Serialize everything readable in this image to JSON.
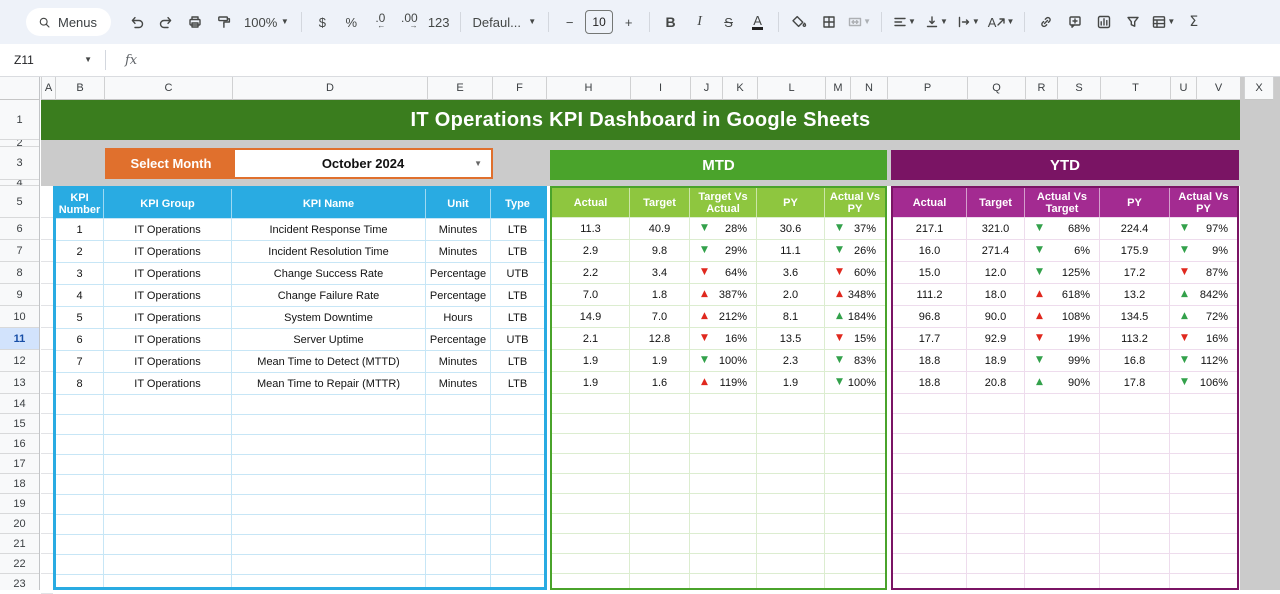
{
  "toolbar": {
    "menus": "Menus",
    "zoom": "100%",
    "currency": "$",
    "percent": "%",
    "decrease_decimals": ".0",
    "increase_decimals": ".00",
    "more_formats": "123",
    "font": "Defaul...",
    "decrease_font_size": "−",
    "font_size": "10",
    "increase_font_size": "+",
    "bold": "B",
    "italic": "I",
    "strikethrough": "S",
    "text_color": "A",
    "text_rotation": "A",
    "functions": "Σ"
  },
  "formula_bar": {
    "name_box": "Z11",
    "fx": "fx"
  },
  "sheet": {
    "columns": [
      "A",
      "B",
      "C",
      "D",
      "E",
      "F",
      "H",
      "I",
      "J",
      "K",
      "L",
      "M",
      "N",
      "P",
      "Q",
      "R",
      "S",
      "T",
      "U",
      "V",
      "X"
    ],
    "row_count": 23,
    "selected_row": 11,
    "title": "IT Operations KPI Dashboard in Google Sheets",
    "select_month_label": "Select Month",
    "select_month_value": "October 2024",
    "mtd_label": "MTD",
    "ytd_label": "YTD",
    "info_headers": [
      "KPI Number",
      "KPI Group",
      "KPI Name",
      "Unit",
      "Type"
    ],
    "mtd_headers": [
      "Actual",
      "Target",
      "Target Vs Actual",
      "PY",
      "Actual Vs PY"
    ],
    "ytd_headers": [
      "Actual",
      "Target",
      "Actual Vs Target",
      "PY",
      "Actual Vs PY"
    ]
  },
  "kpis": [
    {
      "number": "1",
      "group": "IT Operations",
      "name": "Incident Response Time",
      "unit": "Minutes",
      "type": "LTB",
      "mtd": {
        "actual": "11.3",
        "target": "40.9",
        "target_vs_actual": {
          "arrow": "down",
          "color": "green",
          "value": "28%"
        },
        "py": "30.6",
        "actual_vs_py": {
          "arrow": "down",
          "color": "green",
          "value": "37%"
        }
      },
      "ytd": {
        "actual": "217.1",
        "target": "321.0",
        "actual_vs_target": {
          "arrow": "down",
          "color": "green",
          "value": "68%"
        },
        "py": "224.4",
        "actual_vs_py": {
          "arrow": "down",
          "color": "green",
          "value": "97%"
        }
      }
    },
    {
      "number": "2",
      "group": "IT Operations",
      "name": "Incident Resolution Time",
      "unit": "Minutes",
      "type": "LTB",
      "mtd": {
        "actual": "2.9",
        "target": "9.8",
        "target_vs_actual": {
          "arrow": "down",
          "color": "green",
          "value": "29%"
        },
        "py": "11.1",
        "actual_vs_py": {
          "arrow": "down",
          "color": "green",
          "value": "26%"
        }
      },
      "ytd": {
        "actual": "16.0",
        "target": "271.4",
        "actual_vs_target": {
          "arrow": "down",
          "color": "green",
          "value": "6%"
        },
        "py": "175.9",
        "actual_vs_py": {
          "arrow": "down",
          "color": "green",
          "value": "9%"
        }
      }
    },
    {
      "number": "3",
      "group": "IT Operations",
      "name": "Change Success Rate",
      "unit": "Percentage",
      "type": "UTB",
      "mtd": {
        "actual": "2.2",
        "target": "3.4",
        "target_vs_actual": {
          "arrow": "down",
          "color": "red",
          "value": "64%"
        },
        "py": "3.6",
        "actual_vs_py": {
          "arrow": "down",
          "color": "red",
          "value": "60%"
        }
      },
      "ytd": {
        "actual": "15.0",
        "target": "12.0",
        "actual_vs_target": {
          "arrow": "down",
          "color": "green",
          "value": "125%"
        },
        "py": "17.2",
        "actual_vs_py": {
          "arrow": "down",
          "color": "red",
          "value": "87%"
        }
      }
    },
    {
      "number": "4",
      "group": "IT Operations",
      "name": "Change Failure Rate",
      "unit": "Percentage",
      "type": "LTB",
      "mtd": {
        "actual": "7.0",
        "target": "1.8",
        "target_vs_actual": {
          "arrow": "up",
          "color": "red",
          "value": "387%"
        },
        "py": "2.0",
        "actual_vs_py": {
          "arrow": "up",
          "color": "red",
          "value": "348%"
        }
      },
      "ytd": {
        "actual": "111.2",
        "target": "18.0",
        "actual_vs_target": {
          "arrow": "up",
          "color": "red",
          "value": "618%"
        },
        "py": "13.2",
        "actual_vs_py": {
          "arrow": "up",
          "color": "green",
          "value": "842%"
        }
      }
    },
    {
      "number": "5",
      "group": "IT Operations",
      "name": "System Downtime",
      "unit": "Hours",
      "type": "LTB",
      "mtd": {
        "actual": "14.9",
        "target": "7.0",
        "target_vs_actual": {
          "arrow": "up",
          "color": "red",
          "value": "212%"
        },
        "py": "8.1",
        "actual_vs_py": {
          "arrow": "up",
          "color": "green",
          "value": "184%"
        }
      },
      "ytd": {
        "actual": "96.8",
        "target": "90.0",
        "actual_vs_target": {
          "arrow": "up",
          "color": "red",
          "value": "108%"
        },
        "py": "134.5",
        "actual_vs_py": {
          "arrow": "up",
          "color": "green",
          "value": "72%"
        }
      }
    },
    {
      "number": "6",
      "group": "IT Operations",
      "name": "Server Uptime",
      "unit": "Percentage",
      "type": "UTB",
      "mtd": {
        "actual": "2.1",
        "target": "12.8",
        "target_vs_actual": {
          "arrow": "down",
          "color": "red",
          "value": "16%"
        },
        "py": "13.5",
        "actual_vs_py": {
          "arrow": "down",
          "color": "red",
          "value": "15%"
        }
      },
      "ytd": {
        "actual": "17.7",
        "target": "92.9",
        "actual_vs_target": {
          "arrow": "down",
          "color": "red",
          "value": "19%"
        },
        "py": "113.2",
        "actual_vs_py": {
          "arrow": "down",
          "color": "red",
          "value": "16%"
        }
      }
    },
    {
      "number": "7",
      "group": "IT Operations",
      "name": "Mean Time to Detect (MTTD)",
      "unit": "Minutes",
      "type": "LTB",
      "mtd": {
        "actual": "1.9",
        "target": "1.9",
        "target_vs_actual": {
          "arrow": "down",
          "color": "green",
          "value": "100%"
        },
        "py": "2.3",
        "actual_vs_py": {
          "arrow": "down",
          "color": "green",
          "value": "83%"
        }
      },
      "ytd": {
        "actual": "18.8",
        "target": "18.9",
        "actual_vs_target": {
          "arrow": "down",
          "color": "green",
          "value": "99%"
        },
        "py": "16.8",
        "actual_vs_py": {
          "arrow": "down",
          "color": "green",
          "value": "112%"
        }
      }
    },
    {
      "number": "8",
      "group": "IT Operations",
      "name": "Mean Time to Repair (MTTR)",
      "unit": "Minutes",
      "type": "LTB",
      "mtd": {
        "actual": "1.9",
        "target": "1.6",
        "target_vs_actual": {
          "arrow": "up",
          "color": "red",
          "value": "119%"
        },
        "py": "1.9",
        "actual_vs_py": {
          "arrow": "down",
          "color": "green",
          "value": "100%"
        }
      },
      "ytd": {
        "actual": "18.8",
        "target": "20.8",
        "actual_vs_target": {
          "arrow": "up",
          "color": "green",
          "value": "90%"
        },
        "py": "17.8",
        "actual_vs_py": {
          "arrow": "down",
          "color": "green",
          "value": "106%"
        }
      }
    }
  ],
  "colors": {
    "title_bg": "#3a7d1e",
    "section_grey": "#cbcbcb",
    "orange": "#e0702d",
    "info_header": "#29abe2",
    "mtd_header": "#4aa32b",
    "mtd_subheader": "#8ec63f",
    "ytd_header": "#7a1464",
    "ytd_subheader": "#a32b91",
    "arrow_green": "#33a14b",
    "arrow_red": "#e0281e",
    "selected_row_bg": "#d2e3fc"
  }
}
